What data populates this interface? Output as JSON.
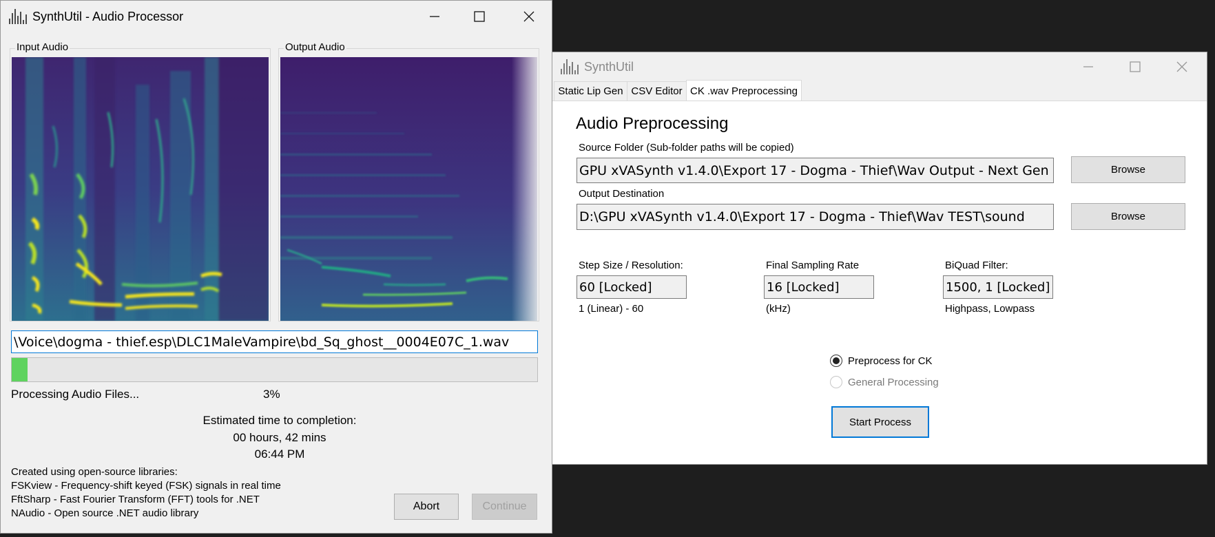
{
  "processor": {
    "title": "SynthUtil - Audio Processor",
    "input_label": "Input Audio",
    "output_label": "Output Audio",
    "current_file": "\\Voice\\dogma - thief.esp\\DLC1MaleVampire\\bd_Sq_ghost__0004E07C_1.wav",
    "progress_percent": 3,
    "progress_percent_label": "3%",
    "status_text": "Processing Audio Files...",
    "eta_heading": "Estimated time to completion:",
    "eta_duration": "00 hours, 42 mins",
    "eta_time": "06:44 PM",
    "credits": [
      "Created using open-source libraries:",
      "FSKview - Frequency-shift keyed (FSK) signals in real time",
      "FftSharp - Fast Fourier Transform (FFT) tools for .NET",
      "NAudio - Open source .NET audio library"
    ],
    "abort_label": "Abort",
    "continue_label": "Continue"
  },
  "main": {
    "title": "SynthUtil",
    "tabs": [
      "Static Lip Gen",
      "CSV Editor",
      "CK .wav Preprocessing"
    ],
    "active_tab": "CK .wav Preprocessing",
    "heading": "Audio Preprocessing",
    "source_label": "Source Folder (Sub-folder paths will be copied)",
    "source_value": "GPU xVASynth v1.4.0\\Export 17 - Dogma - Thief\\Wav Output - Next Gen",
    "output_label": "Output Destination",
    "output_value": "D:\\GPU xVASynth v1.4.0\\Export 17 - Dogma - Thief\\Wav TEST\\sound",
    "browse_label": "Browse",
    "step": {
      "label": "Step Size / Resolution:",
      "value": "60 [Locked]",
      "hint": "1 (Linear) - 60"
    },
    "sampling": {
      "label": "Final Sampling Rate",
      "value": "16 [Locked]",
      "hint": "(kHz)"
    },
    "biquad": {
      "label": "BiQuad Filter:",
      "value": "1500, 1 [Locked]",
      "hint": "Highpass, Lowpass"
    },
    "radio_ck": "Preprocess for CK",
    "radio_general": "General Processing",
    "start_label": "Start Process"
  },
  "colors": {
    "spectro_bg": "#3b1f5e",
    "spectro_blue": "#2a6f8e",
    "spectro_teal": "#21a38a",
    "spectro_yellow": "#f5e51b",
    "progress_green": "#5fd35f",
    "accent_border": "#0078d7"
  }
}
